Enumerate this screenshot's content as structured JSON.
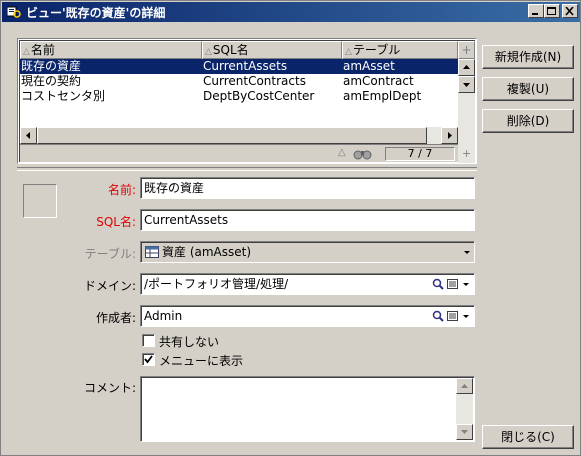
{
  "window": {
    "title": "ビュー'既存の資産'の詳細"
  },
  "list": {
    "columns": [
      "名前",
      "SQL名",
      "テーブル"
    ],
    "rows": [
      {
        "name": "既存の資産",
        "sql": "CurrentAssets",
        "table": "amAsset",
        "selected": true
      },
      {
        "name": "現在の契約",
        "sql": "CurrentContracts",
        "table": "amContract",
        "selected": false
      },
      {
        "name": "コストセンタ別",
        "sql": "DeptByCostCenter",
        "table": "amEmplDept",
        "selected": false
      }
    ],
    "count": "7 / 7"
  },
  "buttons": {
    "new": "新規作成(N)",
    "duplicate": "複製(U)",
    "delete": "削除(D)",
    "close": "閉じる(C)"
  },
  "form": {
    "name_label": "名前:",
    "name_value": "既存の資産",
    "sql_label": "SQL名:",
    "sql_value": "CurrentAssets",
    "table_label": "テーブル:",
    "table_value": "資産 (amAsset)",
    "domain_label": "ドメイン:",
    "domain_value": "/ポートフォリオ管理/処理/",
    "author_label": "作成者:",
    "author_value": "Admin",
    "not_shared_label": "共有しない",
    "not_shared_checked": false,
    "show_in_menu_label": "メニューに表示",
    "show_in_menu_checked": true,
    "comment_label": "コメント:",
    "comment_value": ""
  },
  "colors": {
    "selection": "#0a246a",
    "required_label": "#e00000",
    "face": "#d4d0c8"
  }
}
